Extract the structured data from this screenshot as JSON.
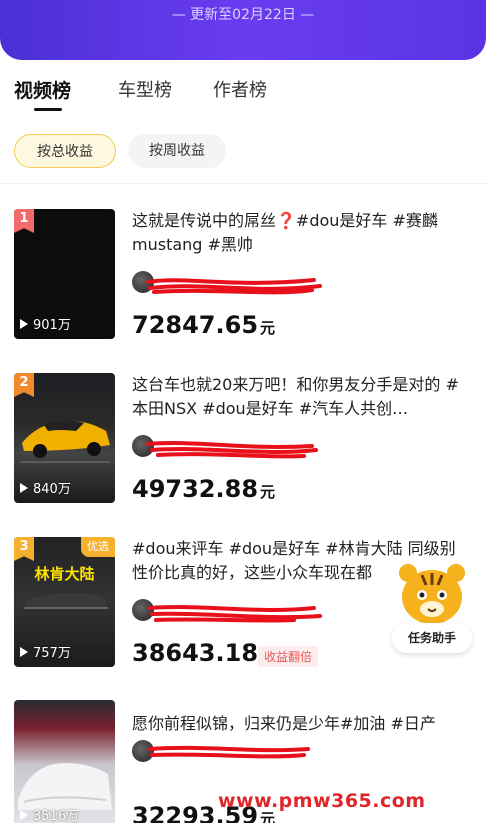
{
  "header": {
    "updated_text": "— 更新至02月22日 —",
    "accent": "#5a34e4"
  },
  "tabs": [
    {
      "label": "视频榜",
      "active": true
    },
    {
      "label": "车型榜",
      "active": false
    },
    {
      "label": "作者榜",
      "active": false
    }
  ],
  "filters": [
    {
      "label": "按总收益",
      "active": true
    },
    {
      "label": "按周收益",
      "active": false
    }
  ],
  "items": [
    {
      "rank": "1",
      "rank_color": "#f26a6a",
      "plays": "901万",
      "title": "这就是传说中的屌丝❓#dou是好车 #赛麟mustang #黑帅",
      "earnings": "72847.65",
      "unit": "元",
      "badge": ""
    },
    {
      "rank": "2",
      "rank_color": "#f08a2a",
      "plays": "840万",
      "title": "这台车也就20来万吧！和你男友分手是对的 #本田NSX #dou是好车 #汽车人共创…",
      "earnings": "49732.88",
      "unit": "元",
      "badge": ""
    },
    {
      "rank": "3",
      "rank_color": "#f5b12e",
      "plays": "757万",
      "title": "#dou来评车 #dou是好车 #林肯大陆 同级别性价比真的好，这些小众车现在都",
      "earnings": "38643.18",
      "unit": "元",
      "badge": "收益翻倍",
      "thumb_caption": "林肯大陆",
      "corner_tag": "优选"
    },
    {
      "rank": "",
      "rank_color": "#cccccc",
      "plays": "3516万",
      "title": "愿你前程似锦，归来仍是少年#加油 #日产",
      "earnings": "32293.59",
      "unit": "元",
      "badge": ""
    }
  ],
  "helper": {
    "label": "任务助手"
  },
  "watermark": "www.pmw365.com"
}
